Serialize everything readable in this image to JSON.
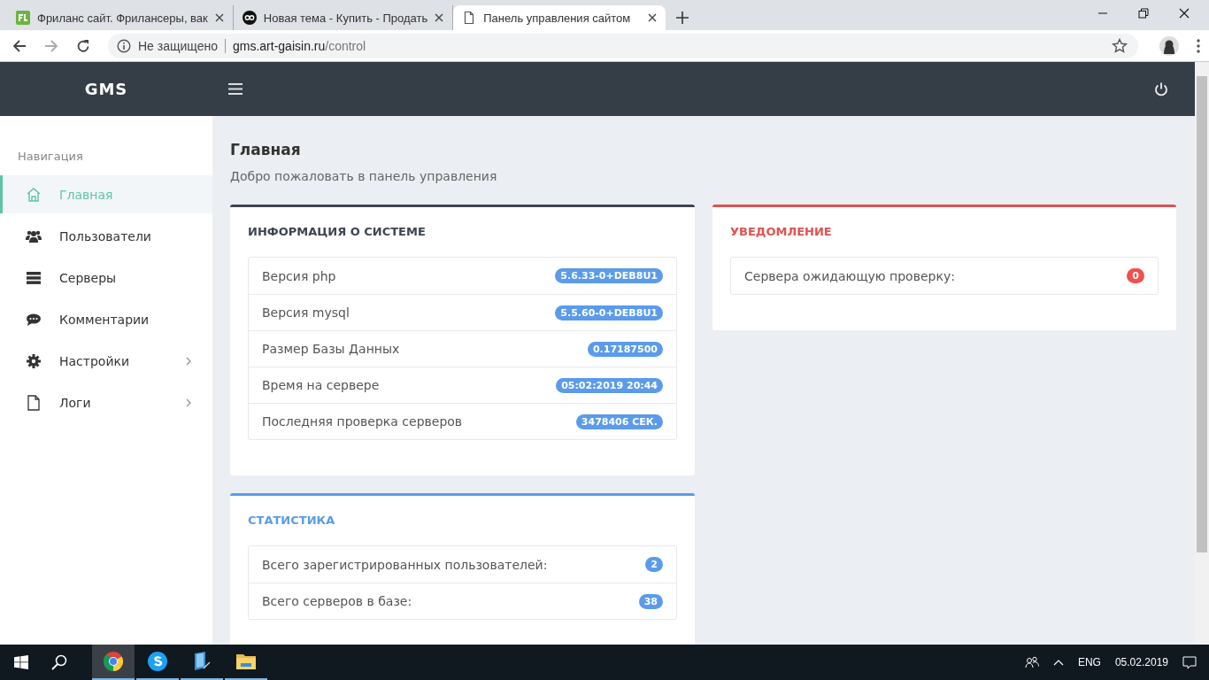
{
  "browser": {
    "tabs": [
      {
        "kind": "fl",
        "title": "Фриланс сайт. Фрилансеры, вак",
        "selected": false
      },
      {
        "kind": "cs",
        "title": "Новая тема - Купить - Продать",
        "selected": false
      },
      {
        "kind": "page",
        "title": "Панель управления сайтом",
        "selected": true
      }
    ],
    "address": {
      "security": "Не защищено",
      "host": "gms.art-gaisin.ru",
      "path": "/control"
    }
  },
  "app": {
    "brand": "GMS",
    "sidebar": {
      "heading": "Навигация",
      "items": [
        {
          "kind": "home",
          "label": "Главная",
          "selected": true,
          "submenu": false
        },
        {
          "kind": "users",
          "label": "Пользователи",
          "selected": false,
          "submenu": false
        },
        {
          "kind": "servers",
          "label": "Серверы",
          "selected": false,
          "submenu": false
        },
        {
          "kind": "comment",
          "label": "Комментарии",
          "selected": false,
          "submenu": false
        },
        {
          "kind": "gear",
          "label": "Настройки",
          "selected": false,
          "submenu": true
        },
        {
          "kind": "file",
          "label": "Логи",
          "selected": false,
          "submenu": true
        }
      ]
    },
    "content": {
      "title": "Главная",
      "subtitle": "Добро пожаловать в панель управления",
      "columns": [
        {
          "cards": [
            {
              "kind": "dark",
              "title": "ИНФОРМАЦИЯ О СИСТЕМЕ",
              "rows": [
                {
                  "label": "Версия php",
                  "value": "5.6.33-0+DEB8U1"
                },
                {
                  "label": "Версия mysql",
                  "value": "5.5.60-0+DEB8U1"
                },
                {
                  "label": "Размер Базы Данных",
                  "value": "0.17187500"
                },
                {
                  "label": "Время на сервере",
                  "value": "05:02:2019 20:44"
                },
                {
                  "label": "Последняя проверка серверов",
                  "value": "3478406 СЕК."
                }
              ]
            },
            {
              "kind": "primary",
              "title": "СТАТИСТИКА",
              "rows": [
                {
                  "label": "Всего зарегистрированных пользователей:",
                  "value": "2"
                },
                {
                  "label": "Всего серверов в базе:",
                  "value": "38"
                }
              ]
            }
          ]
        },
        {
          "cards": [
            {
              "kind": "danger",
              "title": "УВЕДОМЛЕНИЕ",
              "rows": [
                {
                  "label": "Сервера ожидающую проверку:",
                  "value": "0"
                }
              ]
            }
          ]
        }
      ]
    }
  },
  "taskbar": {
    "apps": [
      {
        "kind": "chrome",
        "selected": true
      },
      {
        "kind": "skype",
        "selected": false
      },
      {
        "kind": "notes",
        "selected": false
      },
      {
        "kind": "folder",
        "selected": false
      }
    ],
    "tray": {
      "language": "ENG",
      "date": "05.02.2019"
    }
  }
}
